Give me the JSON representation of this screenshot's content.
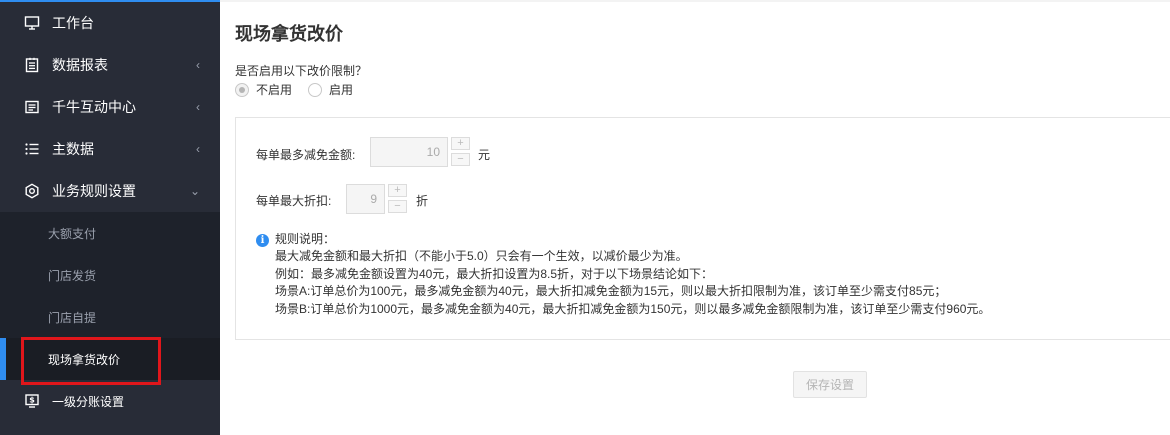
{
  "sidebar": {
    "items": [
      {
        "label": "工作台",
        "icon": "monitor-icon",
        "chevron": ""
      },
      {
        "label": "数据报表",
        "icon": "report-icon",
        "chevron": "‹"
      },
      {
        "label": "千牛互动中心",
        "icon": "message-list-icon",
        "chevron": "‹"
      },
      {
        "label": "主数据",
        "icon": "list-icon",
        "chevron": "‹"
      },
      {
        "label": "业务规则设置",
        "icon": "gear-icon",
        "chevron": "⌄"
      }
    ],
    "subitems": [
      {
        "label": "大额支付"
      },
      {
        "label": "门店发货"
      },
      {
        "label": "门店自提"
      },
      {
        "label": "现场拿货改价"
      }
    ],
    "bottom_item": {
      "label": "一级分账设置",
      "icon": "dollar-screen-icon"
    },
    "accent_color": "#2f8df0",
    "highlight_color": "#e0161b"
  },
  "main": {
    "title": "现场拿货改价",
    "question": "是否启用以下改价限制？",
    "radio_options": [
      {
        "label": "不启用",
        "checked": true
      },
      {
        "label": "启用",
        "checked": false
      }
    ],
    "fields": [
      {
        "label": "每单最多减免金额:",
        "value": "10",
        "unit": "元",
        "plus": "+",
        "minus": "−"
      },
      {
        "label": "每单最大折扣:",
        "value": "9",
        "unit": "折",
        "plus": "+",
        "minus": "−"
      }
    ],
    "rules": {
      "icon": "info-icon",
      "icon_glyph": "i",
      "lines": [
        "规则说明：",
        "最大减免金额和最大折扣（不能小于5.0）只会有一个生效，以减价最少为准。",
        "例如：最多减免金额设置为40元，最大折扣设置为8.5折，对于以下场景结论如下：",
        "场景A:订单总价为100元，最多减免金额为40元，最大折扣减免金额为15元，则以最大折扣限制为准，该订单至少需支付85元；",
        "场景B:订单总价为1000元，最多减免金额为40元，最大折扣减免金额为150元，则以最多减免金额限制为准，该订单至少需支付960元。"
      ]
    },
    "save_label": "保存设置"
  }
}
